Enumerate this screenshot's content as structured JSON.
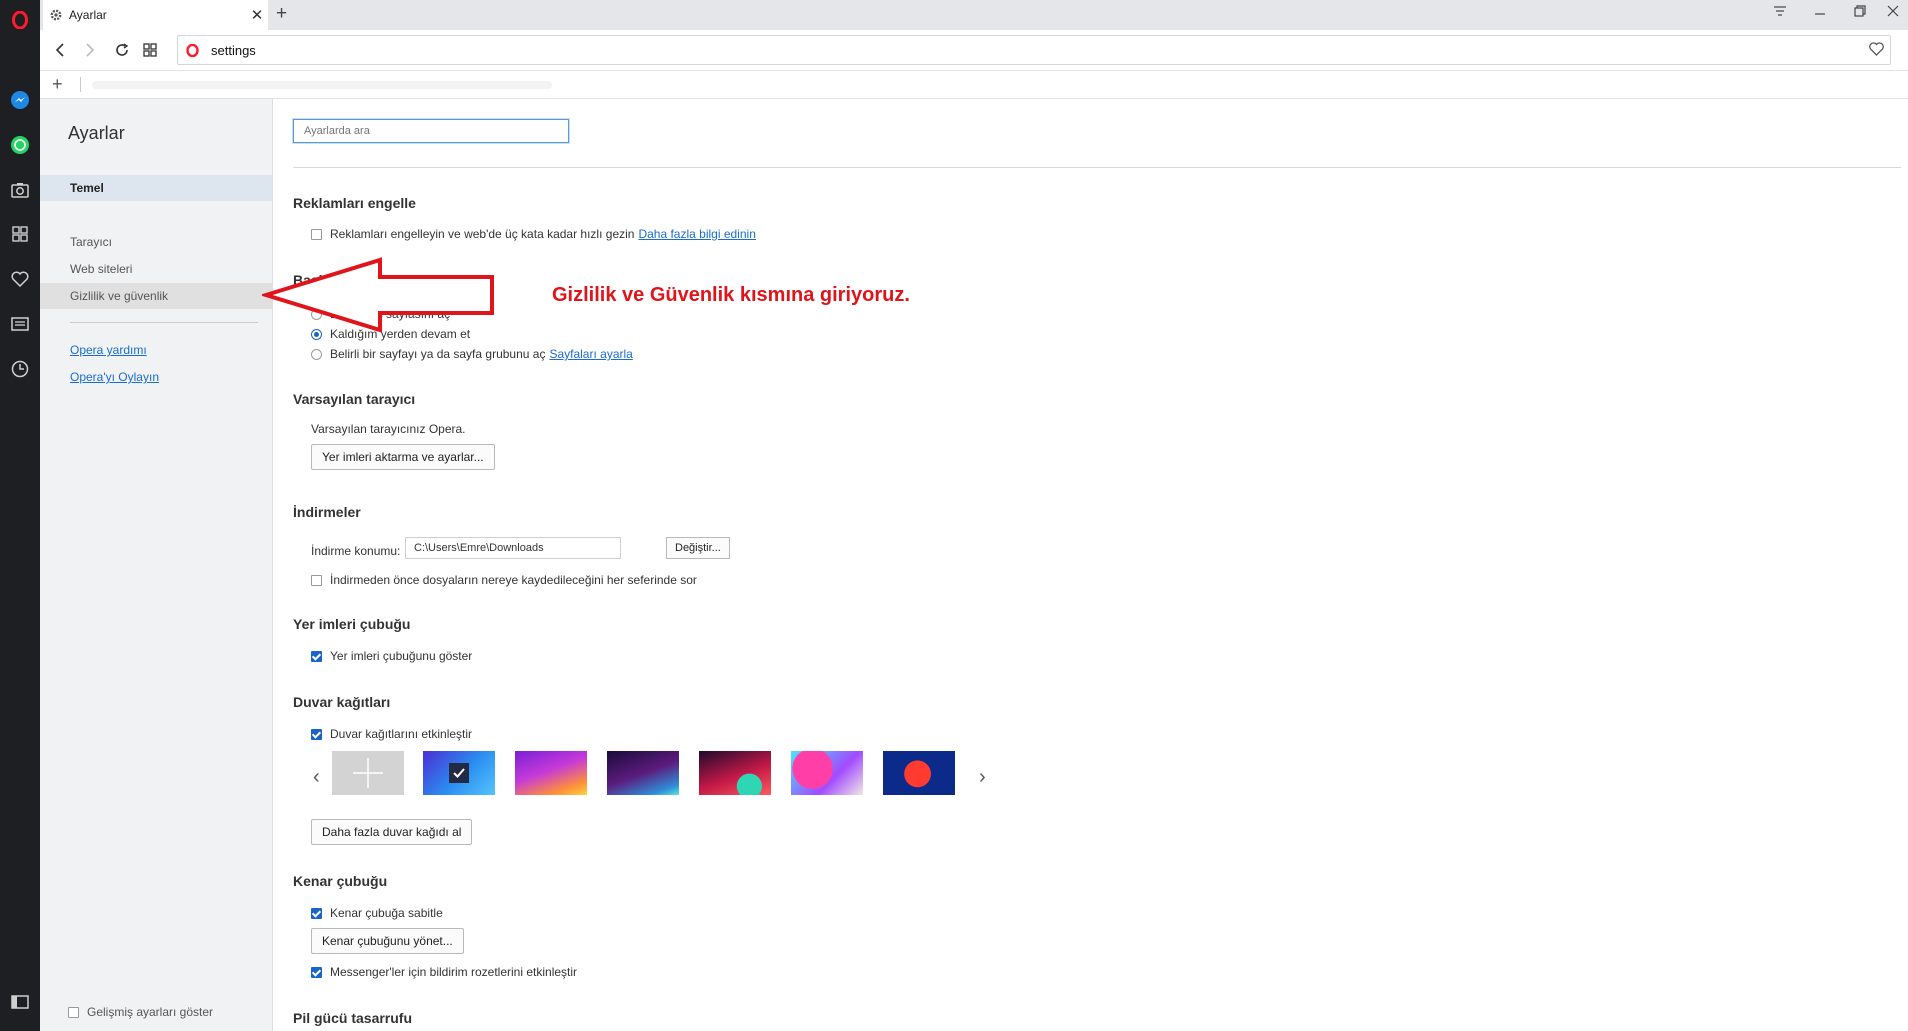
{
  "browser": {
    "tab_title": "Ayarlar",
    "address": "settings"
  },
  "sidebar_nav": {
    "title": "Ayarlar",
    "items": [
      {
        "label": "Temel",
        "selected": true
      },
      {
        "label": "Tarayıcı"
      },
      {
        "label": "Web siteleri"
      },
      {
        "label": "Gizlilik ve güvenlik"
      }
    ],
    "links": [
      "Opera yardımı",
      "Opera'yı Oylayın"
    ],
    "advanced_label": "Gelişmiş ayarları göster"
  },
  "search": {
    "placeholder": "Ayarlarda ara"
  },
  "sections": {
    "ads": {
      "title": "Reklamları engelle",
      "checkbox": "Reklamları engelleyin ve web'de üç kata kadar hızlı gezin",
      "link": "Daha fazla bilgi edinin"
    },
    "startup": {
      "title": "Başlangıçta",
      "option1": "Başlangıç sayfasını aç",
      "option2": "Kaldığım yerden devam et",
      "option3": "Belirli bir sayfayı ya da sayfa grubunu aç",
      "option3_link": "Sayfaları ayarla"
    },
    "default_browser": {
      "title": "Varsayılan tarayıcı",
      "text": "Varsayılan tarayıcınız Opera.",
      "button": "Yer imleri aktarma ve ayarlar..."
    },
    "downloads": {
      "title": "İndirmeler",
      "location_label": "İndirme konumu:",
      "location_value": "C:\\Users\\Emre\\Downloads",
      "change_button": "Değiştir...",
      "ask_checkbox": "İndirmeden önce dosyaların nereye kaydedileceğini her seferinde sor"
    },
    "bookmarks_bar": {
      "title": "Yer imleri çubuğu",
      "checkbox": "Yer imleri çubuğunu göster"
    },
    "wallpapers": {
      "title": "Duvar kağıtları",
      "checkbox": "Duvar kağıtlarını etkinleştir",
      "button": "Daha fazla duvar kağıdı al"
    },
    "sidebar": {
      "title": "Kenar çubuğu",
      "pin_checkbox": "Kenar çubuğa sabitle",
      "manage_button": "Kenar çubuğunu yönet...",
      "badges_checkbox": "Messenger'ler için bildirim rozetlerini etkinleştir"
    },
    "battery": {
      "title": "Pil gücü tasarrufu"
    }
  },
  "annotation": {
    "text": "Gizlilik ve Güvenlik kısmına giriyoruz.",
    "color": "#e0151b"
  },
  "icons": [
    "opera-logo-icon",
    "messenger-icon",
    "whatsapp-icon",
    "camera-icon",
    "speed-dial-icon",
    "heart-icon",
    "news-icon",
    "history-icon",
    "sidebar-toggle-icon"
  ]
}
